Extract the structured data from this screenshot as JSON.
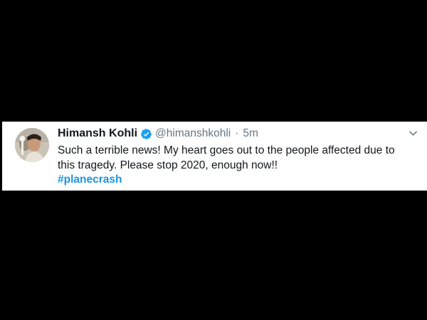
{
  "tweet": {
    "author": {
      "display_name": "Himansh Kohli",
      "handle": "@himanshkohli",
      "verified": true,
      "avatar_icon": "profile-photo"
    },
    "separator": "·",
    "timestamp": "5m",
    "text_line1": "Such a terrible news! My heart goes out to the people affected due to",
    "text_line2": "this tragedy. Please stop 2020, enough now!!",
    "hashtag": "#planecrash",
    "menu_icon": "chevron-down-icon"
  },
  "colors": {
    "background": "#000000",
    "card": "#ffffff",
    "text": "#14171a",
    "secondary_text": "#657786",
    "link": "#1b95e0",
    "verified_badge": "#1da1f2"
  }
}
